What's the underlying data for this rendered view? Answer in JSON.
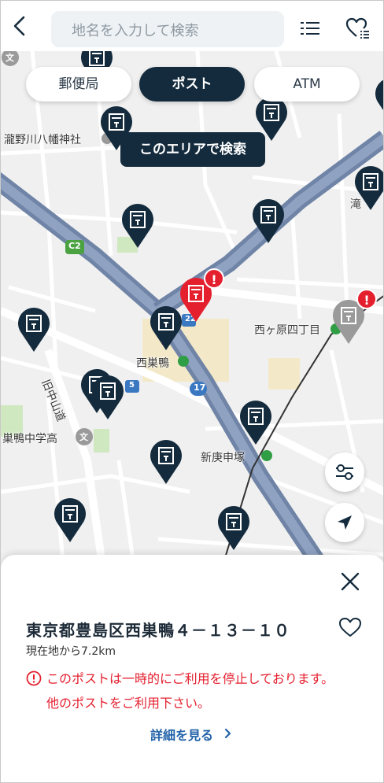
{
  "header": {
    "search_placeholder": "地名を入力して検索"
  },
  "filters": {
    "post_office": "郵便局",
    "post": "ポスト",
    "atm": "ATM",
    "selected": "post"
  },
  "map": {
    "area_search_label": "このエリアで検索",
    "labels": {
      "shrine": "瀧野川八幡神社",
      "station_nishisugamo": "西巣鴨",
      "nishigahara": "西ヶ原四丁目",
      "kyu_nakasendo": "旧中山道",
      "school": "巣鴨中学高",
      "shinkoshinzuka": "新庚申塚",
      "taki": "滝",
      "c2": "C2",
      "route17": "17",
      "route5": "5",
      "route22": "22",
      "bunkyo": "文"
    },
    "badge_mark": "!",
    "colors": {
      "pin": "#142b3d",
      "pin_selected": "#e4202f",
      "pin_disabled": "#9a9a9a",
      "expressway": "#6f84a6",
      "park": "#cfe8c0",
      "area_highlight": "#f3e6b6"
    }
  },
  "sheet": {
    "address": "東京都豊島区西巣鴨４－１３－１０",
    "distance": "現在地から7.2km",
    "notice_line1": "このポストは一時的にご利用を停止しております。",
    "notice_line2": "他のポストをご利用下さい。",
    "detail_link": "詳細を見る"
  }
}
